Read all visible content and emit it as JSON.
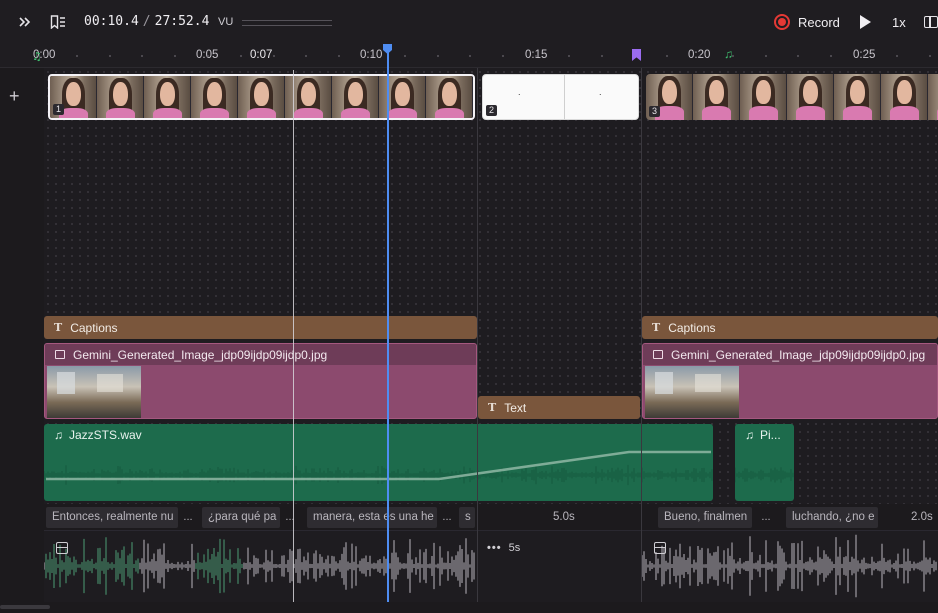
{
  "toolbar": {
    "expand_icon": "chevrons-right-icon",
    "chapters_icon": "bookmark-list-icon",
    "current_time": "00:10.4",
    "separator": "/",
    "total_time": "27:52.4",
    "vu_label": "VU",
    "record_label": "Record",
    "speed_label": "1x",
    "panel_icon": "sidebar-panel-icon"
  },
  "ruler": {
    "ticks": [
      "0:00",
      "0:05",
      "0:07",
      "0:10",
      "0:15",
      "0:20",
      "0:25"
    ]
  },
  "tracks": {
    "add_track": "+",
    "video_clips": [
      {
        "number": "1"
      },
      {
        "number": "2",
        "frame_marks": [
          ".",
          "."
        ]
      },
      {
        "number": "3"
      }
    ],
    "captions": [
      {
        "label": "Captions"
      },
      {
        "label": "Captions"
      }
    ],
    "images": [
      {
        "label": "Gemini_Generated_Image_jdp09ijdp09ijdp0.jpg"
      },
      {
        "label": "Gemini_Generated_Image_jdp09ijdp09ijdp0.jpg"
      }
    ],
    "text_clip": {
      "label": "Text"
    },
    "audio": [
      {
        "label": "JazzSTS.wav"
      },
      {
        "label": "Pi..."
      }
    ]
  },
  "caption_strip": {
    "segments": [
      "Entonces, realmente nu",
      "...",
      "¿para qué pa",
      "...",
      "manera, esta es una he",
      "...",
      "s",
      "5.0s",
      "Bueno, finalmen",
      "...",
      "luchando, ¿no e",
      "2.0s"
    ]
  },
  "waveform": {
    "gap_label": "5s",
    "gap_icon": "more-dots-icon"
  },
  "colors": {
    "playhead": "#4f8df2",
    "record": "#e53935",
    "caption_track": "#7a563c",
    "image_track": "#8c4a6e",
    "audio_track": "#1d6b4c",
    "marker": "#9b6cf0"
  }
}
